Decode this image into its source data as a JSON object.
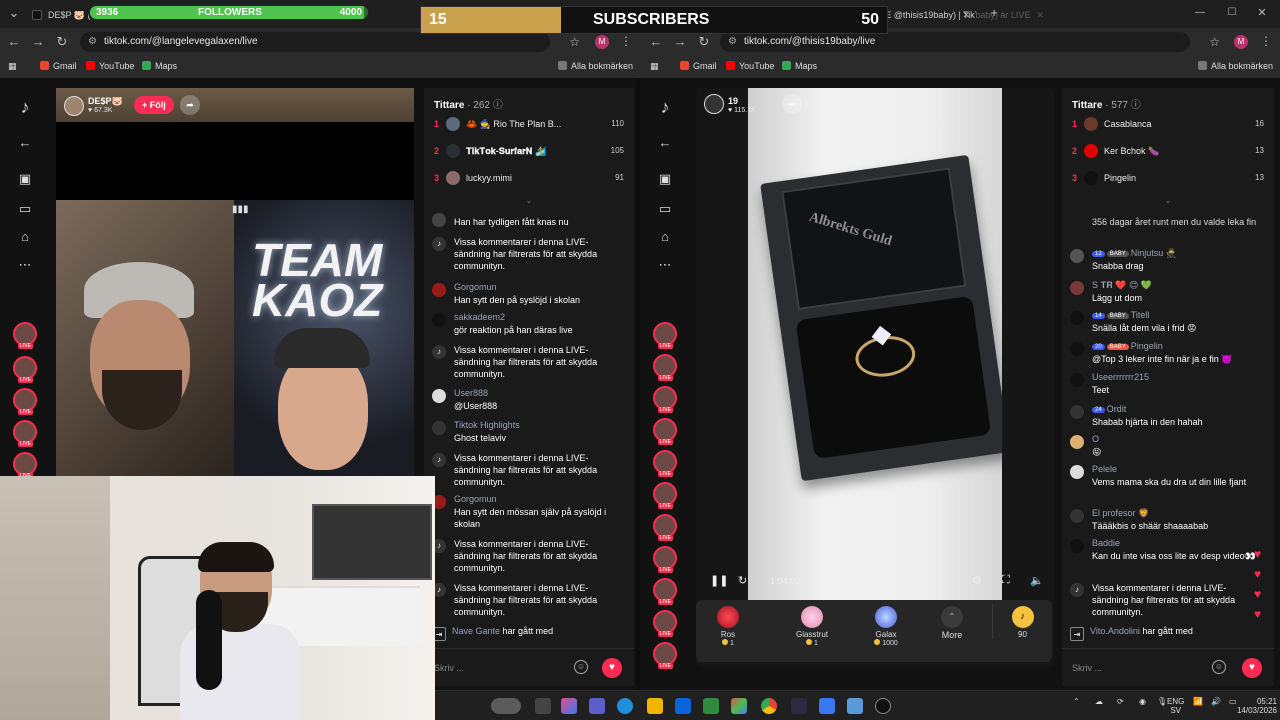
{
  "overlay": {
    "followers": {
      "label": "FOLLOWERS",
      "current": "3936",
      "goal": "4000",
      "progress": 0.984
    },
    "subscribers": {
      "label": "SUBSCRIBERS",
      "current": "15",
      "goal": "50",
      "progress": 0.3
    }
  },
  "left_window": {
    "tab_title": "DE$P 🐷 (@",
    "url": "tiktok.com/@langelevegalaxen/live",
    "bookmarks": [
      "Gmail",
      "YouTube",
      "Maps"
    ],
    "all_bookmarks": "Alla bokmärken",
    "profile_initial": "M",
    "streamer": {
      "name": "DE$P🐷",
      "likes": "♥ 67.3K",
      "follow_label": "+ Följ"
    },
    "video_text": "TEAM KAOZ",
    "chat": {
      "viewers_label": "Tittare",
      "viewers_count": "· 262",
      "ranking": [
        {
          "rank": "1",
          "name": "🦀 🧙 Rio The Plan B...",
          "score": "110"
        },
        {
          "rank": "2",
          "name": "𝐓𝐢𝐤𝐓𝐨𝐤-𝐒𝐮𝐫𝐟𝐚𝐫𝐍 🏄",
          "score": "105"
        },
        {
          "rank": "3",
          "name": "luckyy.mimi",
          "score": "91"
        }
      ],
      "messages": [
        {
          "user": "",
          "text": "Han har tydligen fått knas nu",
          "system": false
        },
        {
          "user": "",
          "text": "Vissa kommentarer i denna LIVE-sändning har filtrerats för att skydda communityn.",
          "system": true
        },
        {
          "user": "Gorgomun",
          "text": "Han sytt den på syslöjd i skolan",
          "system": false
        },
        {
          "user": "sakkadeem2",
          "text": "gör reaktion på han däras live",
          "system": false
        },
        {
          "user": "",
          "text": "Vissa kommentarer i denna LIVE-sändning har filtrerats för att skydda communityn.",
          "system": true
        },
        {
          "user": "User888",
          "text": "@User888",
          "system": false
        },
        {
          "user": "Tiktok Highlights",
          "text": "Ghost telaviv",
          "system": false
        },
        {
          "user": "",
          "text": "Vissa kommentarer i denna LIVE-sändning har filtrerats för att skydda communityn.",
          "system": true
        },
        {
          "user": "Gorgomun",
          "text": "Han sytt den mössan själv på syslöjd i skolan",
          "system": false
        },
        {
          "user": "",
          "text": "Vissa kommentarer i denna LIVE-sändning har filtrerats för att skydda communityn.",
          "system": true
        },
        {
          "user": "",
          "text": "Vissa kommentarer i denna LIVE-sändning har filtrerats för att skydda communityn.",
          "system": true
        }
      ],
      "joined": {
        "user": "Nave Gante",
        "text": "har gått med"
      },
      "input_placeholder": "Skriv ..."
    }
  },
  "right_window": {
    "tab1_title": "(99+) @thisis19baby) är LIVE",
    "tab2_title": "(99+) LIVE @thisis19baby) | TikTo",
    "url": "tiktok.com/@thisis19baby/live",
    "bookmarks": [
      "Gmail",
      "YouTube",
      "Maps"
    ],
    "all_bookmarks": "Alla bokmärken",
    "profile_initial": "M",
    "streamer": {
      "name": "19",
      "likes": "♥ 115.7K"
    },
    "box_text": "Albrekts Guld",
    "player": {
      "time": "1:04:02"
    },
    "gifts": [
      {
        "name": "Ros",
        "price": "1"
      },
      {
        "name": "Glasstrut",
        "price": "1"
      },
      {
        "name": "Galax",
        "price": "1000"
      }
    ],
    "more_label": "More",
    "coins": "90",
    "chat": {
      "viewers_label": "Tittare",
      "viewers_count": "· 577",
      "ranking": [
        {
          "rank": "1",
          "name": "Casablanca",
          "score": "16"
        },
        {
          "rank": "2",
          "name": "Ker Bchok 🍆",
          "score": "13"
        },
        {
          "rank": "3",
          "name": "Pingelin",
          "score": "13"
        }
      ],
      "messages": [
        {
          "user": "",
          "badge": "",
          "text": "356 dagar året runt men du valde leka fin"
        },
        {
          "user": "Ninjutsu 🥷",
          "badge": "12",
          "badge2": "BABY",
          "text": "Snabba drag"
        },
        {
          "user": "S 𝐓𝐑 ❤️ 😊 💚",
          "badge": "",
          "text": "Lägg ut dom"
        },
        {
          "user": "Titell",
          "badge": "14",
          "badge2": "BABY",
          "text": "Snälla låt dem vila i frid 😡"
        },
        {
          "user": "Pingelin",
          "badge": "20",
          "badge2": "BABY",
          "text": "@Top 3 leker inte fin när ja e fin 👿"
        },
        {
          "user": "Useerrrrrrr215",
          "badge": "",
          "text": "Teet"
        },
        {
          "user": "Ordit",
          "badge": "24",
          "text": "Shabab hjärta in den hahah"
        },
        {
          "user": "O",
          "badge": "",
          "text": "😝"
        },
        {
          "user": "Pelele",
          "badge": "",
          "text": "Vems mama ska du dra ut din lille fjant"
        },
        {
          "user": "El profesor 🦁",
          "badge": "",
          "text": "Täääkbis o shäär shaaaabab"
        },
        {
          "user": "Baddie",
          "badge": "",
          "text": "Kan du inte visa oss lite av desp video👀"
        },
        {
          "user": "",
          "badge": "",
          "text": "Vissa kommentarer i denna LIVE-sändning har filtrerats för att skydda communityn.",
          "system": true
        }
      ],
      "joined": {
        "user": "Vito.Andolini",
        "text": "har gått med"
      },
      "input_placeholder": "Skriv ..."
    }
  },
  "taskbar": {
    "lang": "ENG",
    "lang2": "SV",
    "time": "05:21",
    "date": "14/03/2026"
  },
  "colors": {
    "accent": "#fe2c55",
    "follower_fill": "#4fc24f",
    "subscriber_fill": "#c9a04b"
  }
}
